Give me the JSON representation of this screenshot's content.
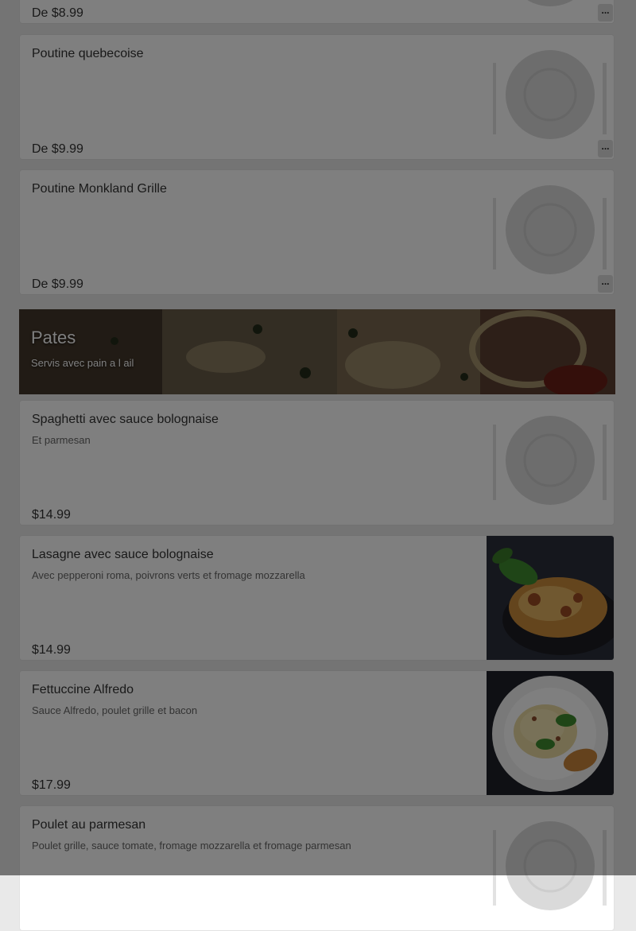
{
  "items_top": [
    {
      "price": "De $8.99",
      "more_label": "..."
    },
    {
      "name": "Poutine quebecoise",
      "price": "De $9.99",
      "more_label": "..."
    },
    {
      "name": "Poutine Monkland Grille",
      "price": "De $9.99",
      "more_label": "..."
    }
  ],
  "section": {
    "title": "Pates",
    "subtitle": "Servis avec pain a l ail"
  },
  "items_pasta": [
    {
      "name": "Spaghetti avec sauce bolognaise",
      "description": "Et parmesan",
      "price": "$14.99",
      "image": "plate-placeholder-icon"
    },
    {
      "name": "Lasagne avec sauce bolognaise",
      "description": "Avec pepperoni roma, poivrons verts et fromage mozzarella",
      "price": "$14.99",
      "image": "lasagna-photo"
    },
    {
      "name": "Fettuccine Alfredo",
      "description": "Sauce Alfredo, poulet grille et bacon",
      "price": "$17.99",
      "image": "fettuccine-photo"
    },
    {
      "name": "Poulet au parmesan",
      "description": "Poulet grille, sauce tomate, fromage mozzarella et fromage parmesan",
      "image": "plate-placeholder-icon"
    }
  ],
  "colors": {
    "card_background": "#ffffff",
    "page_background": "#e9e9e9",
    "overlay": "rgba(0,0,0,0.5)"
  }
}
